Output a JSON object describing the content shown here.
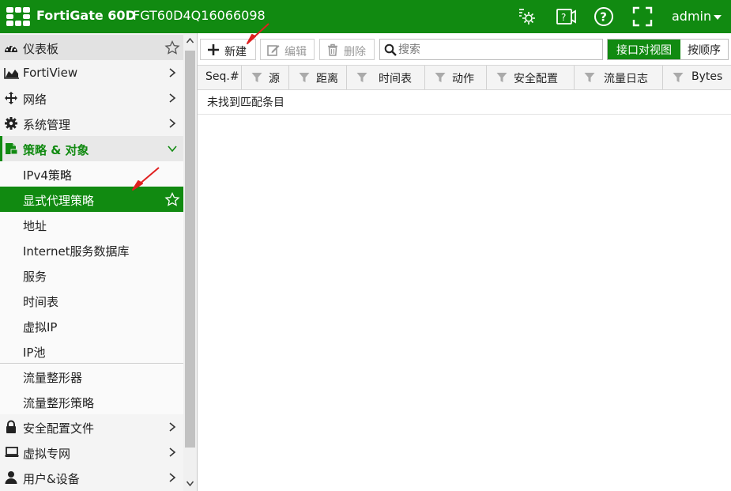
{
  "header": {
    "product": "FortiGate 60D",
    "serial": "FGT60D4Q16066098",
    "user": "admin"
  },
  "sidebar": {
    "items": [
      {
        "label": "仪表板"
      },
      {
        "label": "FortiView"
      },
      {
        "label": "网络"
      },
      {
        "label": "系统管理"
      },
      {
        "label": "策略 & 对象"
      },
      {
        "label": "IPv4策略"
      },
      {
        "label": "显式代理策略"
      },
      {
        "label": "地址"
      },
      {
        "label": "Internet服务数据库"
      },
      {
        "label": "服务"
      },
      {
        "label": "时间表"
      },
      {
        "label": "虚拟IP"
      },
      {
        "label": "IP池"
      },
      {
        "label": "流量整形器"
      },
      {
        "label": "流量整形策略"
      },
      {
        "label": "安全配置文件"
      },
      {
        "label": "虚拟专网"
      },
      {
        "label": "用户&设备"
      }
    ]
  },
  "toolbar": {
    "new_label": "新建",
    "edit_label": "编辑",
    "delete_label": "删除",
    "search_placeholder": "搜索",
    "view_interface": "接口对视图",
    "view_sequence": "按顺序"
  },
  "table": {
    "columns": [
      "Seq.#",
      "源",
      "距离",
      "时间表",
      "动作",
      "安全配置",
      "流量日志",
      "Bytes"
    ],
    "empty_text": "未找到匹配条目"
  },
  "colors": {
    "brand_green": "#118a11",
    "annotation_red": "#e02020"
  }
}
